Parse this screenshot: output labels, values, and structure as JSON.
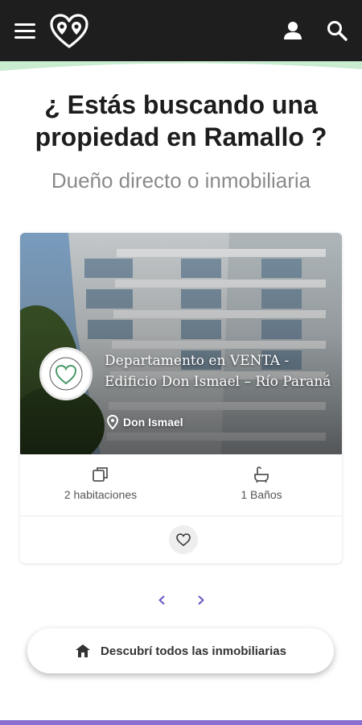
{
  "header": {
    "menu_icon": "hamburger-icon",
    "logo_icon": "heart-pin-logo",
    "user_icon": "user-icon",
    "search_icon": "search-icon",
    "background": "#1e1e1e",
    "accent": "#8fd19e"
  },
  "hero": {
    "title": "¿ Estás buscando una propiedad en Ramallo ?",
    "subtitle": "Dueño directo o inmobiliaria"
  },
  "listing": {
    "title": "Departamento en VENTA - Edificio Don Ismael – Río Paraná",
    "location": "Don Ismael",
    "rooms": "2 habitaciones",
    "baths": "1 Baños",
    "favorite_icon": "heart-outline-icon"
  },
  "pager": {
    "prev_icon": "chevron-left-icon",
    "next_icon": "chevron-right-icon",
    "color": "#6a55c4"
  },
  "discover": {
    "label": "Descubrí todos las inmobiliarias",
    "icon": "house-icon"
  }
}
